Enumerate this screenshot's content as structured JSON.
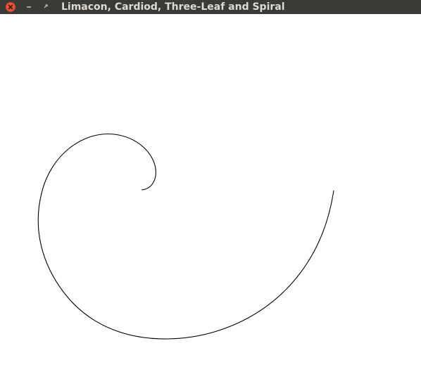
{
  "window": {
    "title": "Limacon, Cardiod, Three-Leaf and Spiral"
  },
  "titlebar_buttons": {
    "close_icon": "close-icon",
    "minimize_icon": "minimize-icon",
    "maximize_icon": "maximize-icon"
  },
  "colors": {
    "titlebar": "#3a3a37",
    "title_text": "#dfdbd2",
    "close_button": "#e8553a",
    "canvas_background": "#ffffff",
    "curve_stroke": "#000000"
  },
  "drawing": {
    "shape": "spiral"
  }
}
